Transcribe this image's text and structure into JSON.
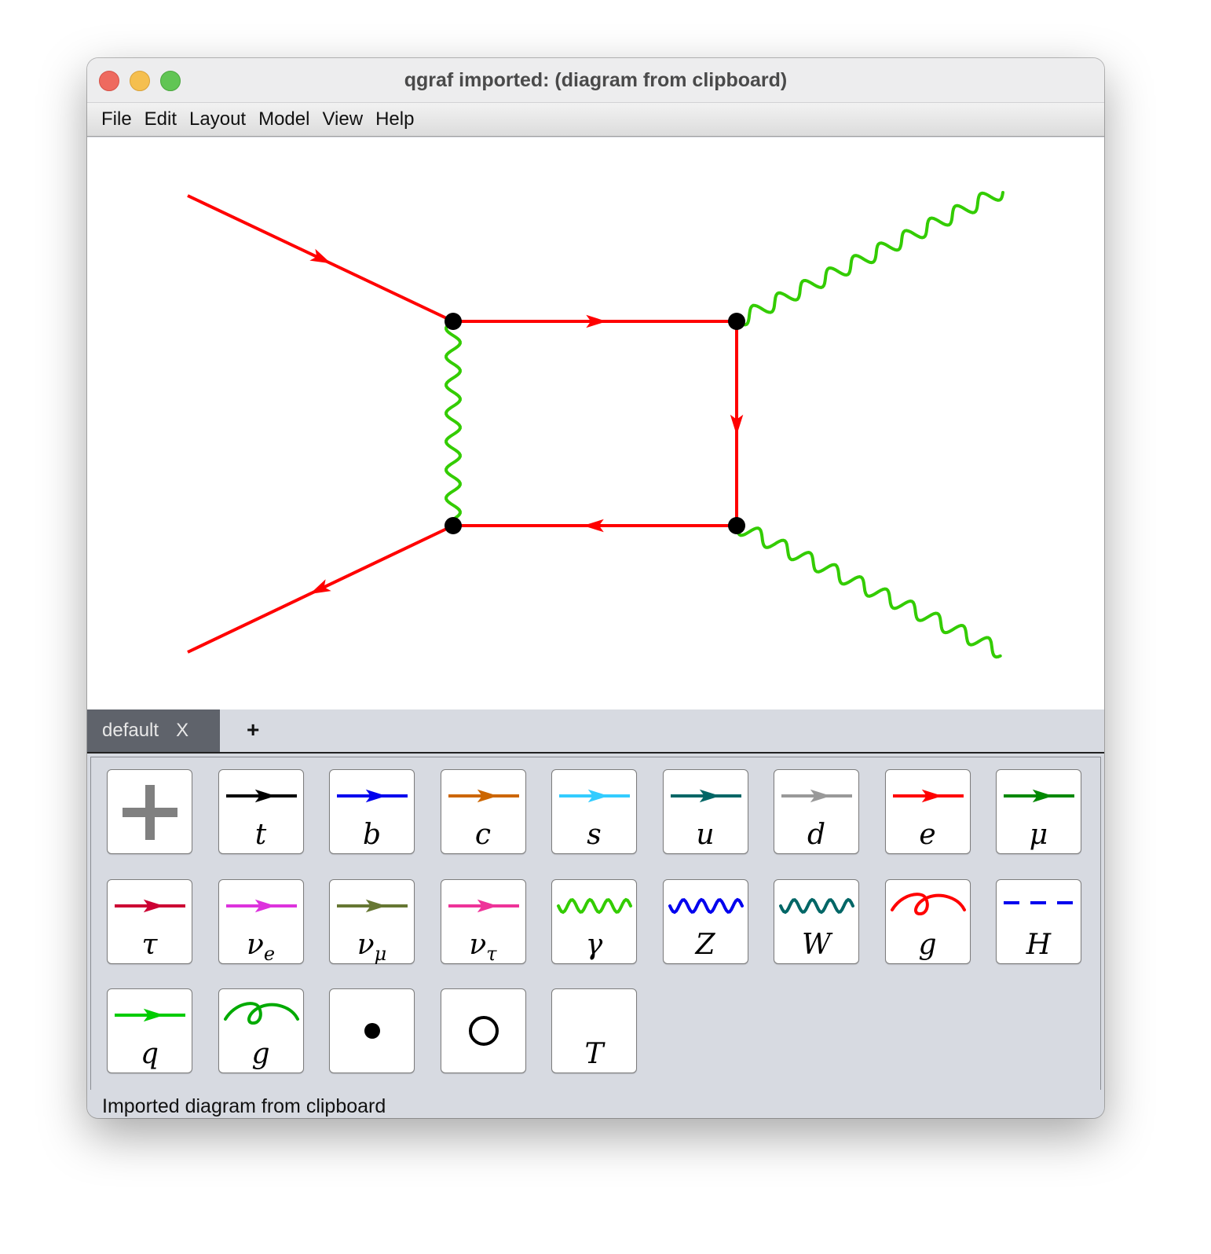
{
  "window": {
    "title": "qgraf imported: (diagram from clipboard)"
  },
  "menu": [
    "File",
    "Edit",
    "Layout",
    "Model",
    "View",
    "Help"
  ],
  "tabs": {
    "active": "default",
    "close_label": "X",
    "add_label": "+"
  },
  "palette": [
    {
      "id": "add",
      "label": "",
      "icon": "plus-icon"
    },
    {
      "id": "t",
      "label": "t",
      "icon": "fermion-line",
      "color": "#000000"
    },
    {
      "id": "b",
      "label": "b",
      "icon": "fermion-line",
      "color": "#0000ee"
    },
    {
      "id": "c",
      "label": "c",
      "icon": "fermion-line",
      "color": "#cc6600"
    },
    {
      "id": "s",
      "label": "s",
      "icon": "fermion-line",
      "color": "#33ccff"
    },
    {
      "id": "u",
      "label": "u",
      "icon": "fermion-line",
      "color": "#006666"
    },
    {
      "id": "d",
      "label": "d",
      "icon": "fermion-line",
      "color": "#999999"
    },
    {
      "id": "e",
      "label": "e",
      "icon": "fermion-line",
      "color": "#ff0000"
    },
    {
      "id": "mu",
      "label": "μ",
      "icon": "fermion-line",
      "color": "#008800"
    },
    {
      "id": "tau",
      "label": "τ",
      "icon": "fermion-line",
      "color": "#cc0033"
    },
    {
      "id": "nu_e",
      "label": "ν",
      "sub": "e",
      "icon": "fermion-line",
      "color": "#dd33dd"
    },
    {
      "id": "nu_mu",
      "label": "ν",
      "sub": "μ",
      "icon": "fermion-line",
      "color": "#667733"
    },
    {
      "id": "nu_tau",
      "label": "ν",
      "sub": "τ",
      "icon": "fermion-line",
      "color": "#ee3399"
    },
    {
      "id": "gamma",
      "label": "γ",
      "icon": "wavy-line",
      "color": "#33cc00"
    },
    {
      "id": "Z",
      "label": "Z",
      "icon": "wavy-line",
      "color": "#0000ee"
    },
    {
      "id": "W",
      "label": "W",
      "icon": "wavy-line",
      "color": "#006666"
    },
    {
      "id": "g1",
      "label": "g",
      "icon": "gluon-loop",
      "color": "#ff0000"
    },
    {
      "id": "H",
      "label": "H",
      "icon": "dashed-line",
      "color": "#0000ee"
    },
    {
      "id": "q",
      "label": "q",
      "icon": "fermion-line",
      "color": "#00cc00"
    },
    {
      "id": "g2",
      "label": "g",
      "icon": "gluon-loop",
      "color": "#00aa00"
    },
    {
      "id": "vertex",
      "label": "",
      "icon": "filled-dot-icon"
    },
    {
      "id": "circle",
      "label": "",
      "icon": "open-circle-icon"
    },
    {
      "id": "T",
      "label": "T",
      "icon": "text-tool"
    }
  ],
  "diagram": {
    "fermion_color": "#ff0000",
    "photon_color": "#33cc00",
    "vertex_color": "#000000"
  },
  "status": "Imported diagram from clipboard"
}
